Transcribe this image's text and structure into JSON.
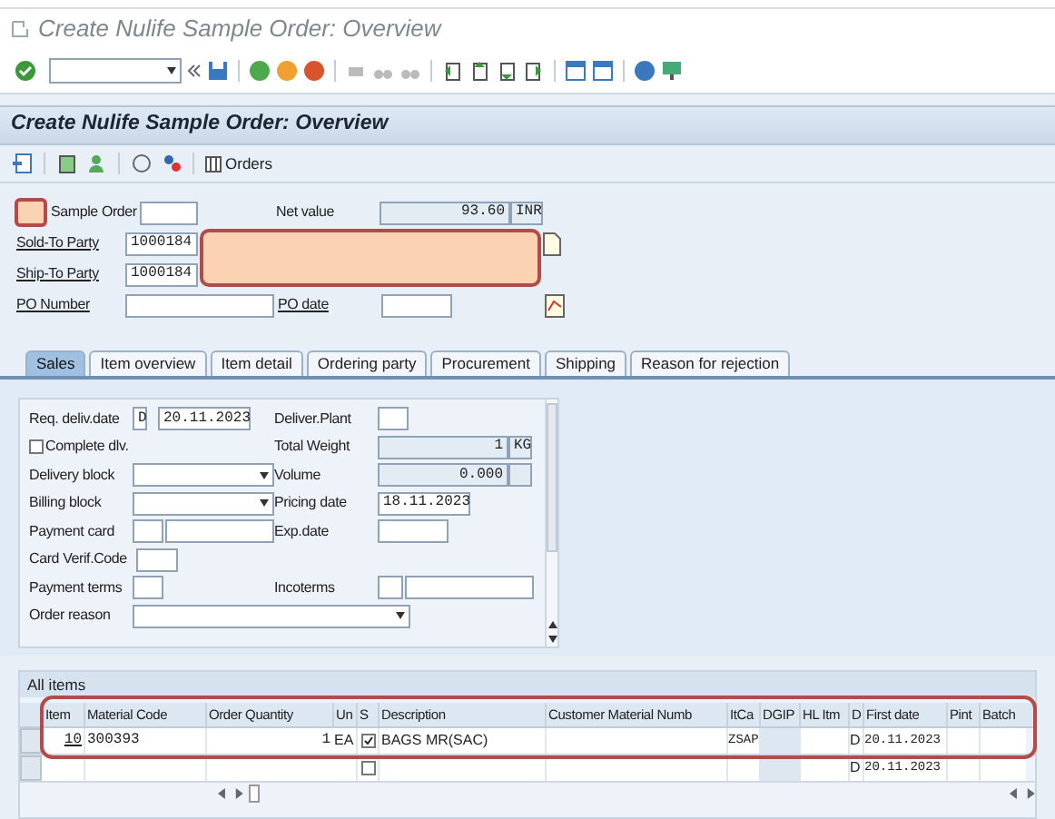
{
  "window": {
    "title": "Create Nulife Sample Order: Overview"
  },
  "screen_title": "Create Nulife Sample Order: Overview",
  "app_toolbar": {
    "orders_button": "Orders"
  },
  "header": {
    "sample_order": {
      "label": "Sample Order"
    },
    "net_value": {
      "label": "Net value",
      "value": "93.60",
      "currency": "INR"
    },
    "sold_to": {
      "label": "Sold-To Party",
      "value": "1000184"
    },
    "ship_to": {
      "label": "Ship-To Party",
      "value": "1000184"
    },
    "po_number": {
      "label": "PO Number"
    },
    "po_date": {
      "label": "PO date"
    }
  },
  "tabs": [
    {
      "label": "Sales",
      "selected": true
    },
    {
      "label": "Item overview",
      "selected": false
    },
    {
      "label": "Item detail",
      "selected": false
    },
    {
      "label": "Ordering party",
      "selected": false
    },
    {
      "label": "Procurement",
      "selected": false
    },
    {
      "label": "Shipping",
      "selected": false
    },
    {
      "label": "Reason for rejection",
      "selected": false
    }
  ],
  "sales": {
    "req_deliv_date": {
      "label": "Req. deliv.date",
      "format": "D",
      "value": "20.11.2023"
    },
    "complete_dlv": {
      "label": "Complete dlv.",
      "checked": false
    },
    "delivery_block": {
      "label": "Delivery block"
    },
    "billing_block": {
      "label": "Billing block"
    },
    "payment_card": {
      "label": "Payment card"
    },
    "card_verif_code": {
      "label": "Card Verif.Code"
    },
    "payment_terms": {
      "label": "Payment terms"
    },
    "order_reason": {
      "label": "Order reason"
    },
    "deliver_plant": {
      "label": "Deliver.Plant"
    },
    "total_weight": {
      "label": "Total Weight",
      "value": "1",
      "unit": "KG"
    },
    "volume": {
      "label": "Volume",
      "value": "0.000"
    },
    "pricing_date": {
      "label": "Pricing date",
      "value": "18.11.2023"
    },
    "exp_date": {
      "label": "Exp.date"
    },
    "incoterms": {
      "label": "Incoterms"
    }
  },
  "items": {
    "title": "All items",
    "columns": [
      "Item",
      "Material Code",
      "Order Quantity",
      "Un",
      "S",
      "Description",
      "Customer Material Numb",
      "ItCa",
      "DGIP",
      "HL Itm",
      "D",
      "First date",
      "Pint",
      "Batch"
    ],
    "rows": [
      {
        "item": "10",
        "material": "300393",
        "quantity": "1",
        "unit": "EA",
        "s_checked": true,
        "description": "BAGS MR(SAC)",
        "itca": "ZSAP",
        "d": "D",
        "first_date": "20.11.2023"
      },
      {
        "s_checked": false,
        "d": "D",
        "first_date": "20.11.2023"
      }
    ]
  }
}
